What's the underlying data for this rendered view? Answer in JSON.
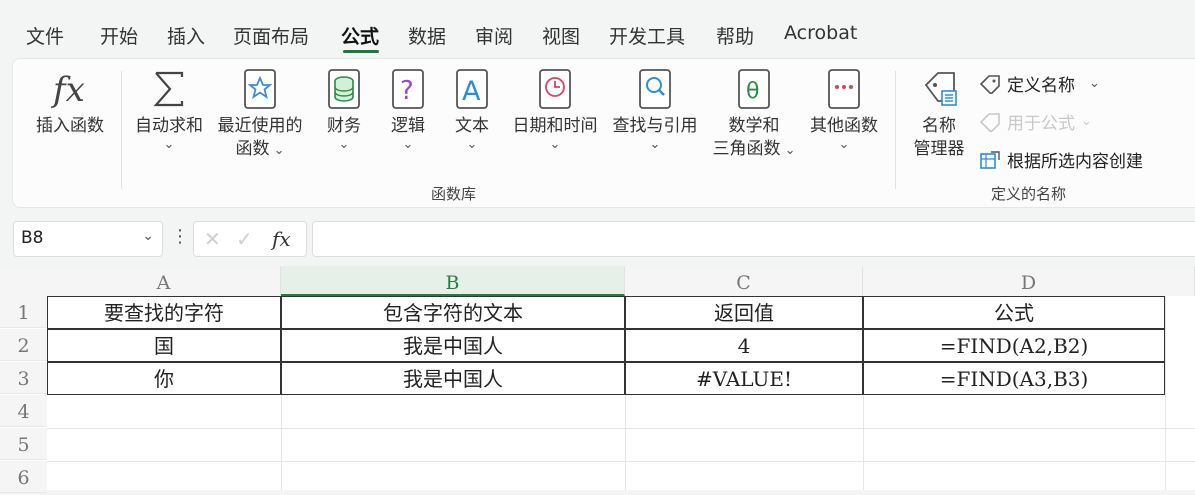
{
  "tabs": [
    "文件",
    "开始",
    "插入",
    "页面布局",
    "公式",
    "数据",
    "审阅",
    "视图",
    "开发工具",
    "帮助",
    "Acrobat"
  ],
  "ribbon": {
    "insert_function": "插入函数",
    "autosum": "自动求和",
    "recent_line1": "最近使用的",
    "recent_line2": "函数",
    "financial": "财务",
    "logical": "逻辑",
    "text": "文本",
    "datetime": "日期和时间",
    "lookup": "查找与引用",
    "math_line1": "数学和",
    "math_line2": "三角函数",
    "more": "其他函数",
    "group_library": "函数库",
    "name_manager_line1": "名称",
    "name_manager_line2": "管理器",
    "define_name": "定义名称",
    "use_in_formula": "用于公式",
    "create_from_selection": "根据所选内容创建",
    "group_defined": "定义的名称"
  },
  "formula_bar": {
    "name_box": "B8",
    "formula": ""
  },
  "columns": [
    "A",
    "B",
    "C",
    "D"
  ],
  "rows": [
    "1",
    "2",
    "3",
    "4",
    "5",
    "6"
  ],
  "cells": [
    [
      "要查找的字符",
      "包含字符的文本",
      "返回值",
      "公式"
    ],
    [
      "国",
      "我是中国人",
      "4",
      "=FIND(A2,B2)"
    ],
    [
      "你",
      "我是中国人",
      "#VALUE!",
      "=FIND(A3,B3)"
    ]
  ],
  "colors": {
    "accent": "#1a7a3c"
  }
}
